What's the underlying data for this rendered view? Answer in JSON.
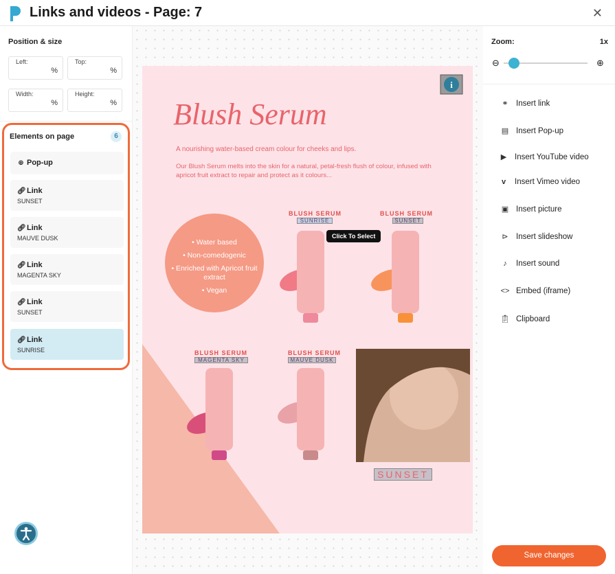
{
  "window": {
    "title": "Links and videos - Page: 7"
  },
  "position_size": {
    "title": "Position & size",
    "fields": [
      {
        "label": "Left:",
        "unit": "%"
      },
      {
        "label": "Top:",
        "unit": "%"
      },
      {
        "label": "Width:",
        "unit": "%"
      },
      {
        "label": "Height:",
        "unit": "%"
      }
    ]
  },
  "elements": {
    "title": "Elements on page",
    "count": "6",
    "items": [
      {
        "type": "Pop-up",
        "sub": ""
      },
      {
        "type": "Link",
        "sub": "SUNSET"
      },
      {
        "type": "Link",
        "sub": "MAUVE DUSK"
      },
      {
        "type": "Link",
        "sub": "MAGENTA SKY"
      },
      {
        "type": "Link",
        "sub": "SUNSET"
      },
      {
        "type": "Link",
        "sub": "SUNRISE"
      }
    ]
  },
  "zoom": {
    "label": "Zoom:",
    "value": "1x",
    "level": 0.05
  },
  "menu": [
    {
      "icon": "link-icon",
      "label": "Insert link"
    },
    {
      "icon": "popup-icon",
      "label": "Insert Pop-up"
    },
    {
      "icon": "youtube-icon",
      "label": "Insert YouTube video"
    },
    {
      "icon": "vimeo-icon",
      "label": "Insert Vimeo video"
    },
    {
      "icon": "picture-icon",
      "label": "Insert picture"
    },
    {
      "icon": "slideshow-icon",
      "label": "Insert slideshow"
    },
    {
      "icon": "sound-icon",
      "label": "Insert sound"
    },
    {
      "icon": "embed-icon",
      "label": "Embed (iframe)"
    },
    {
      "icon": "clipboard-icon",
      "label": "Clipboard"
    }
  ],
  "save_label": "Save changes",
  "page": {
    "title": "Blush Serum",
    "subtitle": "A nourishing water-based cream colour for cheeks and lips.",
    "body": "Our Blush Serum melts into the skin for a natural, petal-fresh flush of colour, infused with apricot fruit extract to repair and protect as it colours...",
    "features": [
      "• Water based",
      "• Non-comedogenic",
      "• Enriched with Apricot fruit extract",
      "• Vegan"
    ],
    "product_name": "BLUSH SERUM",
    "labels": [
      "SUNRISE",
      "SUNSET",
      "MAGENTA SKY",
      "MAUVE DUSK",
      "SUNSET"
    ],
    "tooltip": "Click To Select"
  }
}
